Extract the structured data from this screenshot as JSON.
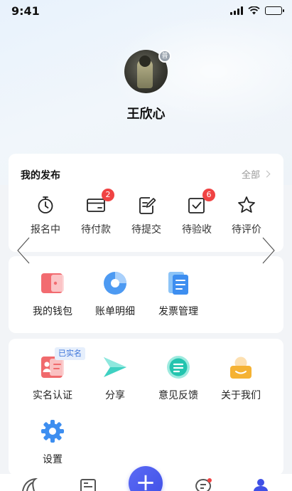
{
  "status_bar": {
    "time": "9:41"
  },
  "profile": {
    "name": "王欣心",
    "avatar_badge": "普"
  },
  "my_posts": {
    "title": "我的发布",
    "view_all": "全部",
    "items": [
      {
        "label": "报名中",
        "icon": "stopwatch-icon",
        "badge": ""
      },
      {
        "label": "待付款",
        "icon": "card-icon",
        "badge": "2"
      },
      {
        "label": "待提交",
        "icon": "edit-doc-icon",
        "badge": ""
      },
      {
        "label": "待验收",
        "icon": "checkbox-icon",
        "badge": "6"
      },
      {
        "label": "待评价",
        "icon": "star-icon",
        "badge": ""
      }
    ]
  },
  "finance": {
    "items": [
      {
        "label": "我的钱包",
        "icon": "wallet-icon"
      },
      {
        "label": "账单明细",
        "icon": "pie-chart-icon"
      },
      {
        "label": "发票管理",
        "icon": "invoice-icon"
      }
    ]
  },
  "services": {
    "verified_tag": "已实名",
    "items": [
      {
        "label": "实名认证",
        "icon": "id-card-icon"
      },
      {
        "label": "分享",
        "icon": "share-arrow-icon"
      },
      {
        "label": "意见反馈",
        "icon": "feedback-icon"
      },
      {
        "label": "关于我们",
        "icon": "about-us-icon"
      },
      {
        "label": "设置",
        "icon": "settings-gear-icon"
      }
    ]
  },
  "tab_bar": {
    "plus": "+",
    "tabs": [
      "home-tab-icon",
      "list-tab-icon",
      "publish-plus-icon",
      "messages-tab-icon",
      "profile-tab-icon"
    ],
    "active_color": "#3f50e6"
  }
}
